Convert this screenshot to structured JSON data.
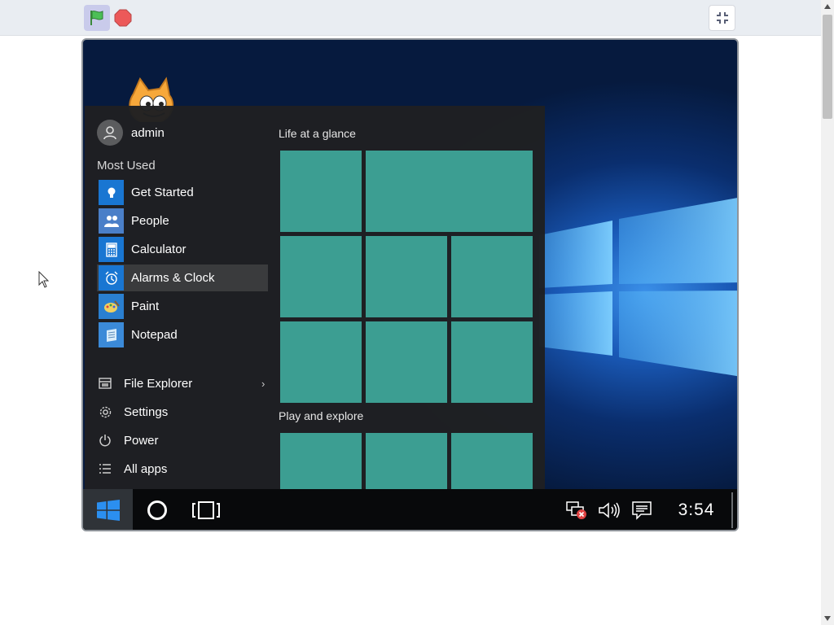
{
  "player": {
    "green_flag_icon": "green-flag-icon",
    "stop_icon": "stop-sign-icon",
    "fullscreen_icon": "exit-fullscreen-icon"
  },
  "start_menu": {
    "user_name": "admin",
    "most_used_label": "Most Used",
    "apps": [
      {
        "label": "Get Started",
        "icon": "lightbulb-icon"
      },
      {
        "label": "People",
        "icon": "people-icon"
      },
      {
        "label": "Calculator",
        "icon": "calculator-icon"
      },
      {
        "label": "Alarms & Clock",
        "icon": "alarm-clock-icon"
      },
      {
        "label": "Paint",
        "icon": "paint-icon"
      },
      {
        "label": "Notepad",
        "icon": "notepad-icon"
      }
    ],
    "system": [
      {
        "label": "File Explorer",
        "icon": "folder-icon"
      },
      {
        "label": "Settings",
        "icon": "gear-icon"
      },
      {
        "label": "Power",
        "icon": "power-icon"
      },
      {
        "label": "All apps",
        "icon": "list-icon"
      }
    ],
    "tile_groups": [
      "Life at a glance",
      "Play and explore"
    ]
  },
  "taskbar": {
    "clock": "3:54"
  },
  "colors": {
    "tile": "#3c9e92",
    "app_icon_bg": "#1976d2",
    "taskbar": "#08090b",
    "start_menu_bg": "#1f2022"
  }
}
